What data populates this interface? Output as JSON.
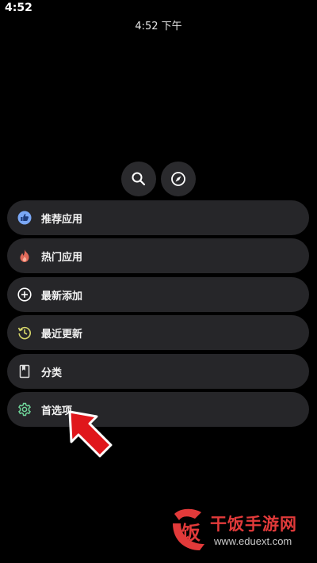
{
  "status_bar": {
    "time": "4:52"
  },
  "header": {
    "time": "4:52 下午"
  },
  "top_buttons": [
    {
      "icon": "search-icon"
    },
    {
      "icon": "compass-icon"
    }
  ],
  "menu": [
    {
      "label": "推荐应用",
      "icon": "thumbs-up-icon",
      "icon_color": "#7aa7f5"
    },
    {
      "label": "热门应用",
      "icon": "fire-icon",
      "icon_color": "#e06a5a"
    },
    {
      "label": "最新添加",
      "icon": "plus-circle-icon",
      "icon_color": "#ffffff"
    },
    {
      "label": "最近更新",
      "icon": "update-icon",
      "icon_color": "#d6d66a"
    },
    {
      "label": "分类",
      "icon": "bookmark-icon",
      "icon_color": "#dddddd"
    },
    {
      "label": "首选项",
      "icon": "gear-icon",
      "icon_color": "#6fd69a"
    }
  ],
  "watermark": {
    "title": "干饭手游网",
    "url": "www.eduext.com",
    "logo_char": "饭"
  },
  "colors": {
    "arrow": "#e0161b",
    "background": "#000000",
    "item_bg": "#262629"
  }
}
